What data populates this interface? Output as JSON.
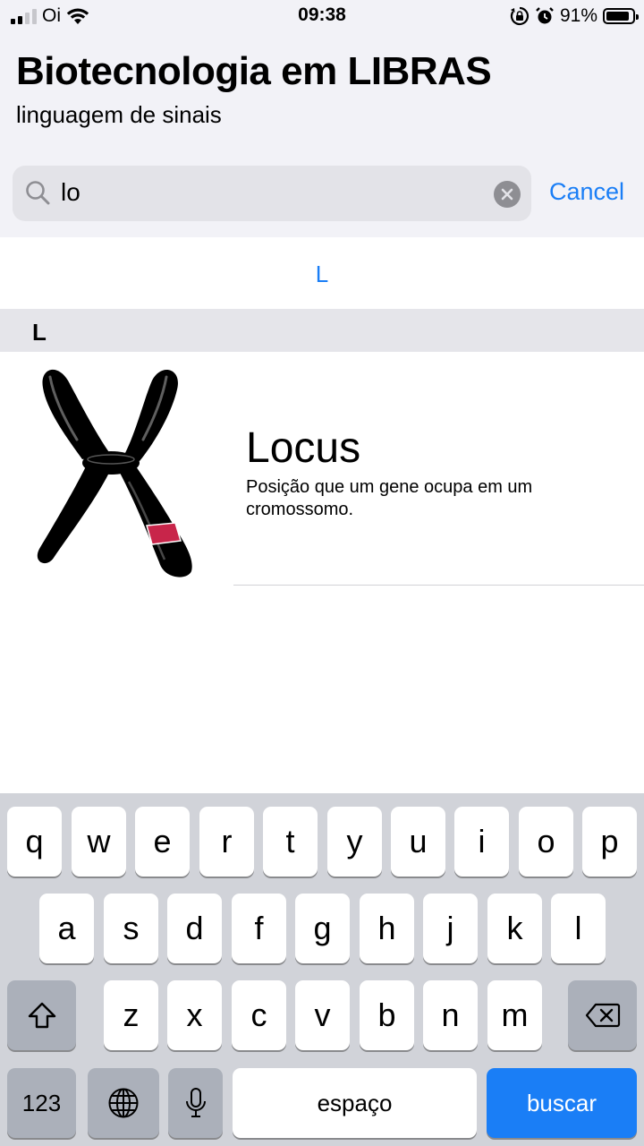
{
  "status_bar": {
    "carrier": "Oi",
    "time": "09:38",
    "battery_percent": "91%",
    "battery_level": 0.91,
    "icons": [
      "signal-icon",
      "wifi-icon",
      "orientation-lock-icon",
      "alarm-icon",
      "battery-icon"
    ]
  },
  "header": {
    "title": "Biotecnologia em LIBRAS",
    "subtitle": "linguagem de sinais"
  },
  "search": {
    "value": "lo",
    "cancel_label": "Cancel"
  },
  "index": {
    "letter": "L"
  },
  "section": {
    "letter": "L"
  },
  "results": [
    {
      "title": "Locus",
      "description": "Posição que um gene ocupa em um cromossomo.",
      "image_icon": "chromosome-icon"
    }
  ],
  "keyboard": {
    "row1": [
      "q",
      "w",
      "e",
      "r",
      "t",
      "y",
      "u",
      "i",
      "o",
      "p"
    ],
    "row2": [
      "a",
      "s",
      "d",
      "f",
      "g",
      "h",
      "j",
      "k",
      "l"
    ],
    "row3": [
      "z",
      "x",
      "c",
      "v",
      "b",
      "n",
      "m"
    ],
    "numbers_label": "123",
    "space_label": "espaço",
    "return_label": "buscar"
  },
  "colors": {
    "accent": "#1a7ef6",
    "header_bg": "#f2f2f7",
    "keyboard_bg": "#d1d3d9",
    "band_red": "#c8254a"
  }
}
